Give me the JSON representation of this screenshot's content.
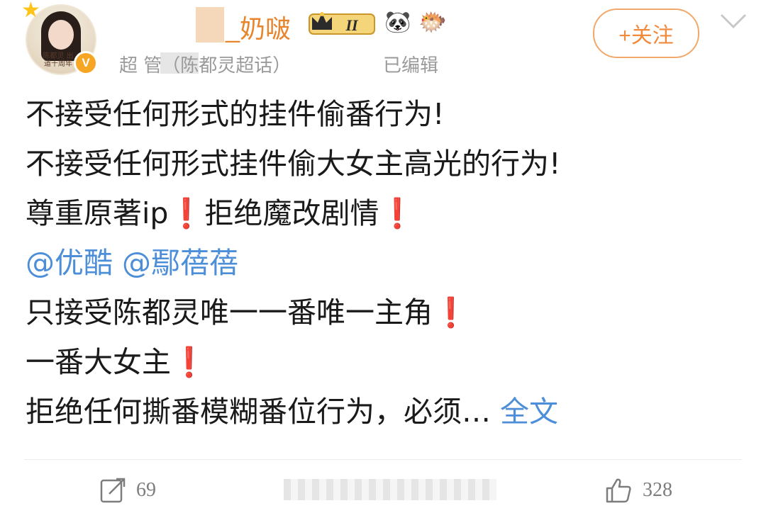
{
  "header": {
    "username": "_奶啵",
    "level_badge": "II",
    "source": "超  管（陈都灵超话）",
    "edited": "已编辑",
    "follow_label": "+关注",
    "avatar_text": "陈都灵 出道十周年",
    "verified_badge": "V",
    "icons": [
      "crown-level-icon",
      "panda-icon",
      "fish-icon",
      "chevron-down-icon"
    ]
  },
  "post": {
    "lines": [
      {
        "text": "不接受任何形式的挂件偷番行为!"
      },
      {
        "text": "不接受任何形式挂件偷大女主高光的行为!"
      },
      {
        "text": "尊重原著ip",
        "mark_after": "❗",
        "text2": "拒绝魔改剧情",
        "mark_end": "❗"
      },
      {
        "mention1": "@优酷",
        "mention2": "@鄢蓓蓓"
      },
      {
        "text": "只接受陈都灵唯一一番唯一主角",
        "mark_end": "❗"
      },
      {
        "text": "一番大女主",
        "mark_end": "❗"
      },
      {
        "text": "拒绝任何撕番模糊番位行为，必须…",
        "more": "全文"
      }
    ]
  },
  "footer": {
    "repost_count": "69",
    "like_count": "328"
  },
  "colors": {
    "mention": "#4d8ed8",
    "username": "#e8852c",
    "follow": "#f08a3c"
  }
}
